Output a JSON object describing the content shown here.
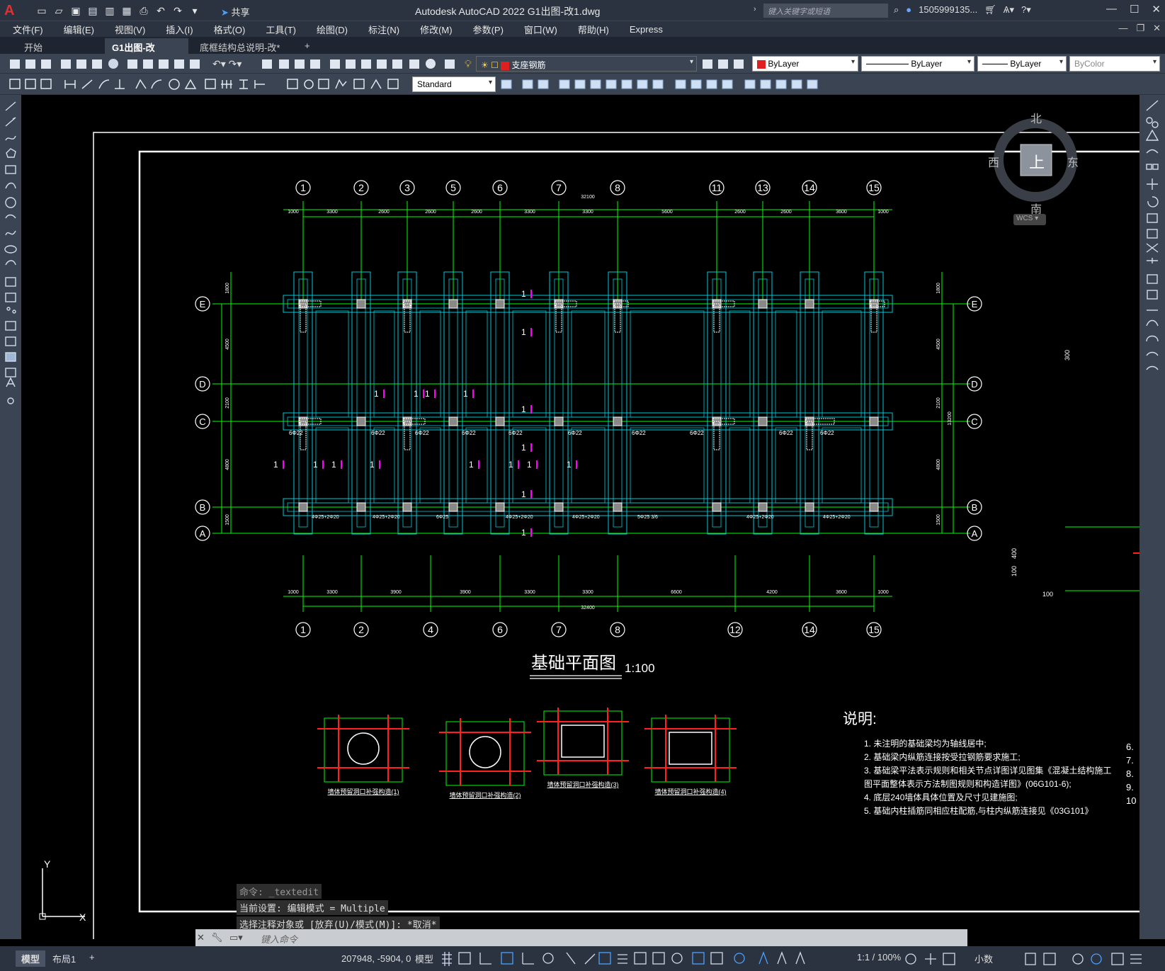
{
  "titlebar": {
    "app_title": "Autodesk AutoCAD 2022    G1出图-改1.dwg",
    "share_label": "共享",
    "search_placeholder": "键入关键字或短语",
    "user_name": "1505999135...",
    "logo_letter": "A"
  },
  "menu": [
    "文件(F)",
    "编辑(E)",
    "视图(V)",
    "插入(I)",
    "格式(O)",
    "工具(T)",
    "绘图(D)",
    "标注(N)",
    "修改(M)",
    "参数(P)",
    "窗口(W)",
    "帮助(H)",
    "Express"
  ],
  "tabs": [
    {
      "label": "开始",
      "active": false
    },
    {
      "label": "G1出图-改1*",
      "active": true
    },
    {
      "label": "底框结构总说明-改*",
      "active": false
    }
  ],
  "layer_combo": {
    "value": "支座钢筋",
    "color": "#e02020"
  },
  "color_combo": {
    "value": "ByLayer"
  },
  "linetype_combo": {
    "value": "ByLayer"
  },
  "lineweight_combo": {
    "value": "ByLayer"
  },
  "plotstyle_combo": {
    "value": "ByColor"
  },
  "textstyle_combo": {
    "value": "Standard"
  },
  "viewcube": {
    "north": "北",
    "south": "南",
    "east": "东",
    "west": "西",
    "top": "上",
    "wcs": "WCS"
  },
  "drawing": {
    "title": "基础平面图",
    "scale": "1:100",
    "top_axes": [
      "1",
      "2",
      "3",
      "5",
      "6",
      "7",
      "8",
      "11",
      "13",
      "14",
      "15"
    ],
    "bottom_axes": [
      "1",
      "2",
      "4",
      "6",
      "7",
      "8",
      "12",
      "14",
      "15"
    ],
    "row_axes": [
      "E",
      "D",
      "C",
      "B",
      "A"
    ],
    "top_dims": [
      "1000",
      "3300",
      "2600",
      "2600",
      "2600",
      "3300",
      "3300",
      "5600",
      "2600",
      "2600",
      "3600",
      "1000"
    ],
    "top_total": "32100",
    "bottom_dims": [
      "1000",
      "3300",
      "3900",
      "3900",
      "3300",
      "3300",
      "6600",
      "4200",
      "3600",
      "1000"
    ],
    "bottom_total": "32400",
    "left_dims": [
      "1800",
      "4500",
      "2100",
      "4800",
      "1500"
    ],
    "left_total": "13200",
    "right_dims": [
      "1800",
      "4500",
      "2100",
      "4800",
      "1500"
    ],
    "right_total": "13200",
    "detail_labels": [
      "墙体预留洞口补强构造(1)",
      "墙体预留洞口补强构造(2)",
      "墙体预留洞口补强构造(3)",
      "墙体预留洞口补强构造(4)"
    ],
    "notes_title": "说明:",
    "notes": [
      "1. 未注明的基础梁均为轴线居中;",
      "2. 基础梁内纵筋连接按受拉钢筋要求施工;",
      "3. 基础梁平法表示规则和相关节点详图详见图集《混凝土结构施工",
      "   图平面整体表示方法制图规则和构造详图》(06G101-6);",
      "4. 底层240墙体具体位置及尺寸见建施图;",
      "5. 基础内柱插筋同相应柱配筋,与柱内纵筋连接见《03G101》"
    ],
    "beam_labels": [
      "6Φ22",
      "6Φ22",
      "6Φ22",
      "6Φ22",
      "6Φ22",
      "6Φ22",
      "6Φ22",
      "6Φ22",
      "6Φ22",
      "6Φ22"
    ],
    "bottom_rebar": [
      "4Φ25+2Φ20",
      "4Φ25+2Φ20",
      "6Φ25",
      "4Φ25+2Φ20",
      "4Φ25+2Φ20",
      "5Φ25 3/6",
      "4Φ25+2Φ20",
      "4Φ25+2Φ20"
    ],
    "right_partial_dims": [
      "300",
      "400",
      "100",
      "100"
    ],
    "side_numbers": [
      "6.",
      "7.",
      "8.",
      "9.",
      "10"
    ]
  },
  "ucs": {
    "y_label": "Y",
    "x_label": "X"
  },
  "command": {
    "history": [
      "命令: _textedit",
      "当前设置: 编辑模式 = Multiple",
      "选择注释对象或 [放弃(U)/模式(M)]: *取消*"
    ],
    "prompt": "键入命令"
  },
  "status": {
    "model_tab": "模型",
    "layout_tab": "布局1",
    "coords": "207948, -5904, 0",
    "space": "模型",
    "scale": "1:1 / 100%",
    "units": "小数"
  }
}
